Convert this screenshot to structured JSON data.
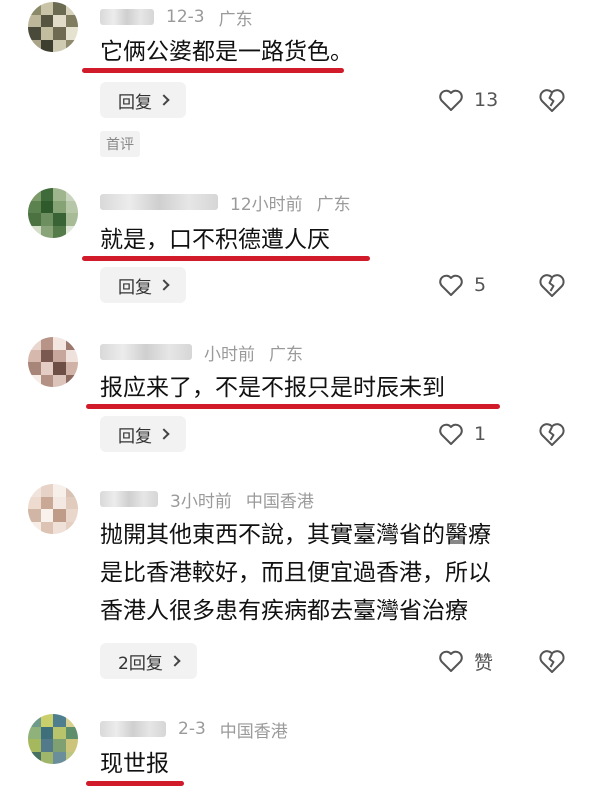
{
  "colors": {
    "accent_underline": "#d11a2a",
    "meta_text": "#9a9a9a",
    "button_bg": "#f2f2f2"
  },
  "comments": [
    {
      "time": "12-3",
      "location": "广东",
      "text": "它俩公婆都是一路货色。",
      "reply_label": "回复",
      "likes": "13",
      "badge": "首评"
    },
    {
      "time": "12小时前",
      "location": "广东",
      "text": "就是，口不积德遭人厌",
      "reply_label": "回复",
      "likes": "5"
    },
    {
      "time": "小时前",
      "location": "广东",
      "text": "报应来了，不是不报只是时辰未到",
      "reply_label": "回复",
      "likes": "1"
    },
    {
      "time": "3小时前",
      "location": "中国香港",
      "text_lines": [
        "抛開其他東西不說，其實臺灣省的醫療",
        "是比香港較好，而且便宜過香港，所以",
        "香港人很多患有疾病都去臺灣省治療"
      ],
      "reply_label": "2回复",
      "likes": "赞"
    },
    {
      "time": "2-3",
      "location": "中国香港",
      "text": "现世报"
    }
  ],
  "icons": {
    "like": "heart-outline-icon",
    "dislike": "broken-heart-icon",
    "reply_more": "chevron-right-icon"
  }
}
